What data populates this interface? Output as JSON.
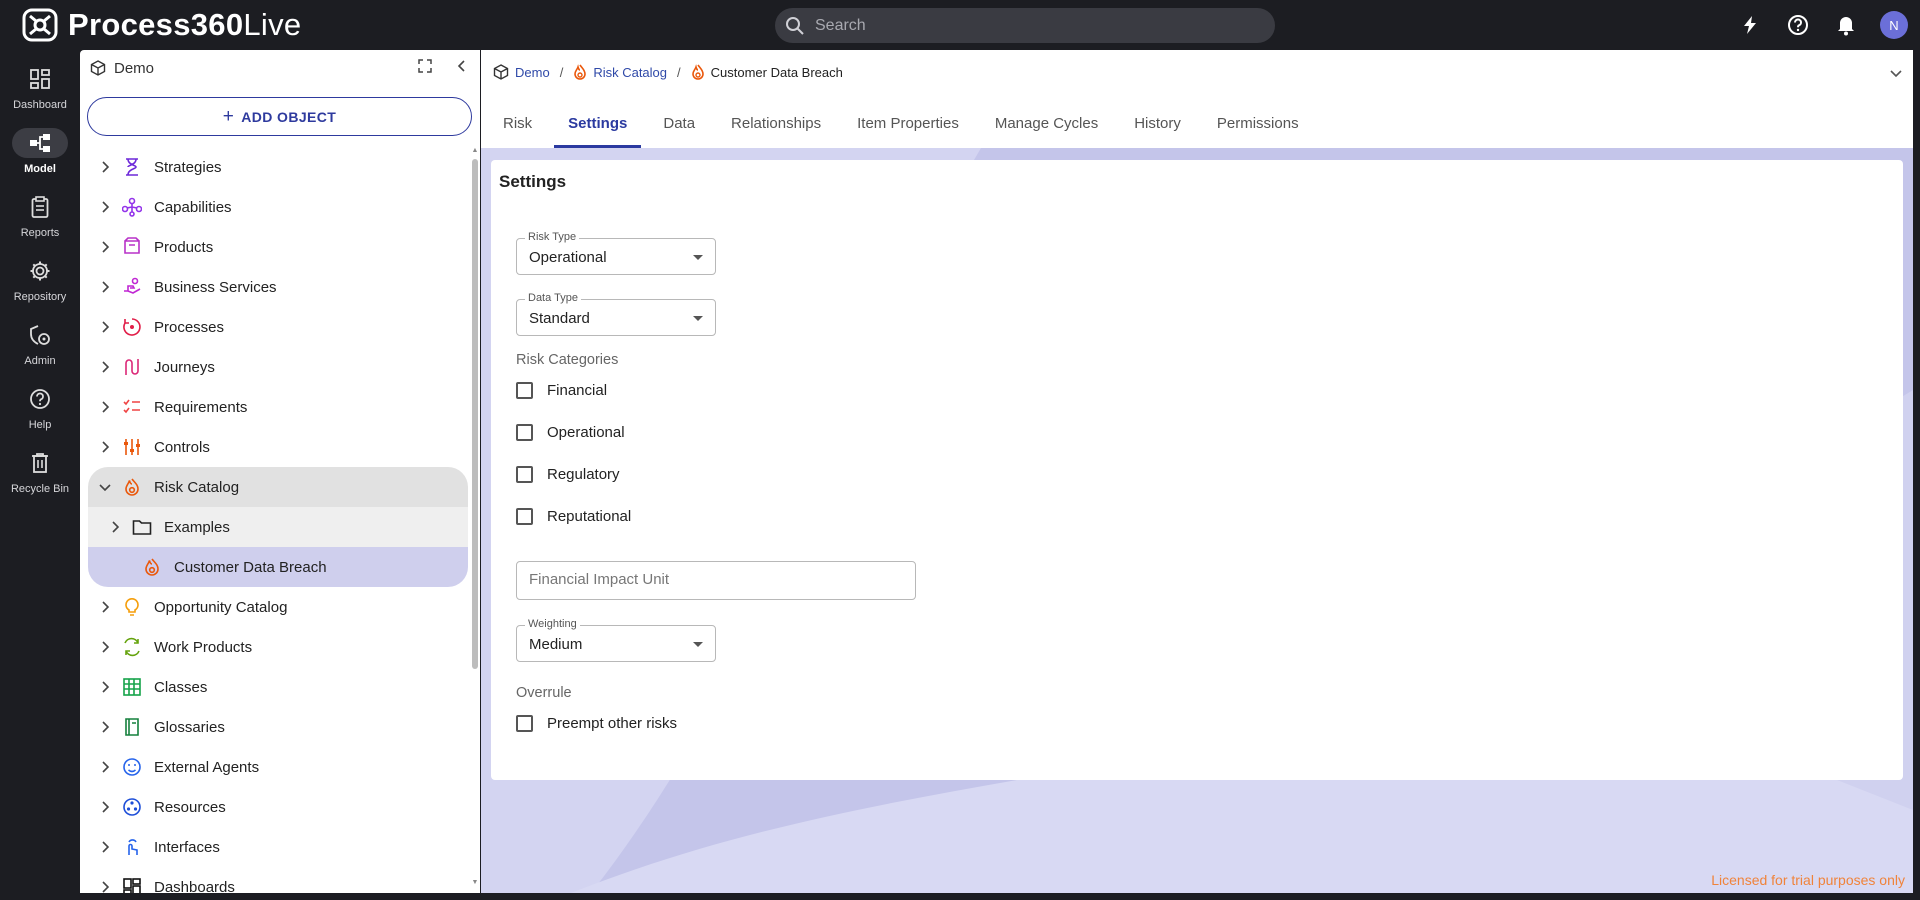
{
  "app": {
    "brand_bold": "Process360",
    "brand_light": "Live"
  },
  "search": {
    "placeholder": "Search"
  },
  "user": {
    "initial": "N"
  },
  "rail": [
    {
      "label": "Dashboard"
    },
    {
      "label": "Model"
    },
    {
      "label": "Reports"
    },
    {
      "label": "Repository"
    },
    {
      "label": "Admin"
    },
    {
      "label": "Help"
    },
    {
      "label": "Recycle Bin"
    }
  ],
  "tree": {
    "workspace": "Demo",
    "add_label": "ADD OBJECT",
    "items": [
      {
        "label": "Strategies",
        "icon": "strategy-icon",
        "color": "#6d28d9"
      },
      {
        "label": "Capabilities",
        "icon": "capability-icon",
        "color": "#9333ea"
      },
      {
        "label": "Products",
        "icon": "product-icon",
        "color": "#b832c8"
      },
      {
        "label": "Business Services",
        "icon": "service-icon",
        "color": "#c026d3"
      },
      {
        "label": "Processes",
        "icon": "process-icon",
        "color": "#e11d48"
      },
      {
        "label": "Journeys",
        "icon": "journey-icon",
        "color": "#db2777"
      },
      {
        "label": "Requirements",
        "icon": "requirements-icon",
        "color": "#ef4444"
      },
      {
        "label": "Controls",
        "icon": "controls-icon",
        "color": "#ea580c"
      },
      {
        "label": "Risk Catalog",
        "icon": "flame-icon",
        "color": "#ea580c"
      },
      {
        "label": "Examples",
        "icon": "folder-icon",
        "color": "#222222"
      },
      {
        "label": "Customer Data Breach",
        "icon": "flame-icon",
        "color": "#ea580c"
      },
      {
        "label": "Opportunity Catalog",
        "icon": "lightbulb-icon",
        "color": "#f59e0b"
      },
      {
        "label": "Work Products",
        "icon": "work-product-icon",
        "color": "#65a30d"
      },
      {
        "label": "Classes",
        "icon": "table-icon",
        "color": "#16a34a"
      },
      {
        "label": "Glossaries",
        "icon": "book-icon",
        "color": "#15803d"
      },
      {
        "label": "External Agents",
        "icon": "agent-icon",
        "color": "#2563eb"
      },
      {
        "label": "Resources",
        "icon": "resource-icon",
        "color": "#1d4ed8"
      },
      {
        "label": "Interfaces",
        "icon": "interface-icon",
        "color": "#2563eb"
      },
      {
        "label": "Dashboards",
        "icon": "dashboard-icon",
        "color": "#111111"
      }
    ]
  },
  "breadcrumb": {
    "root": "Demo",
    "parent": "Risk Catalog",
    "current": "Customer Data Breach"
  },
  "tabs": [
    "Risk",
    "Settings",
    "Data",
    "Relationships",
    "Item Properties",
    "Manage Cycles",
    "History",
    "Permissions"
  ],
  "settings": {
    "title": "Settings",
    "risk_type": {
      "label": "Risk Type",
      "value": "Operational"
    },
    "data_type": {
      "label": "Data Type",
      "value": "Standard"
    },
    "risk_categories_title": "Risk Categories",
    "categories": [
      "Financial",
      "Operational",
      "Regulatory",
      "Reputational"
    ],
    "financial_impact_unit": {
      "placeholder": "Financial Impact Unit"
    },
    "weighting": {
      "label": "Weighting",
      "value": "Medium"
    },
    "overrule_title": "Overrule",
    "preempt_label": "Preempt other risks"
  },
  "footer": {
    "licensed": "Licensed for trial purposes only"
  },
  "colors": {
    "accent": "#2b3aa0",
    "main_bg": "#c8c9ec",
    "risk_orange": "#ea580c"
  }
}
